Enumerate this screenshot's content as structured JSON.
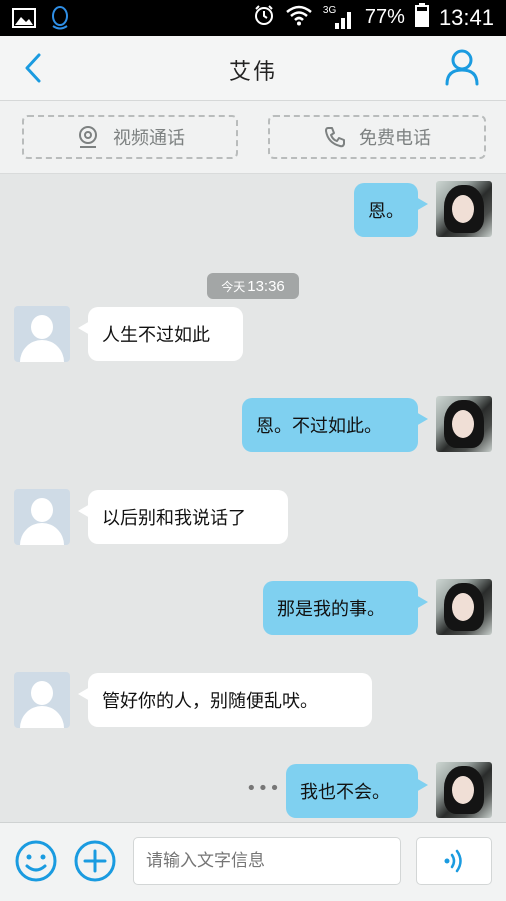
{
  "status_bar": {
    "network": "3G",
    "battery": "77%",
    "time": "13:41"
  },
  "header": {
    "title": "艾伟"
  },
  "call_bar": {
    "video_call": "视频通话",
    "free_call": "免费电话"
  },
  "chat": {
    "timestamp_prefix": "今天",
    "timestamp_time": "13:36",
    "messages": [
      {
        "from": "me",
        "text": "恩。"
      },
      {
        "from": "other",
        "text": "人生不过如此"
      },
      {
        "from": "me",
        "text": "恩。不过如此。"
      },
      {
        "from": "other",
        "text": "以后别和我说话了"
      },
      {
        "from": "me",
        "text": "那是我的事。"
      },
      {
        "from": "other",
        "text": "管好你的人，别随便乱吠。"
      },
      {
        "from": "me",
        "text": "我也不会。"
      }
    ],
    "pending_indicator": "•••"
  },
  "input_bar": {
    "placeholder": "请输入文字信息"
  },
  "colors": {
    "accent": "#1a9be0",
    "my_bubble": "#7fd0f0",
    "other_bubble": "#ffffff"
  }
}
